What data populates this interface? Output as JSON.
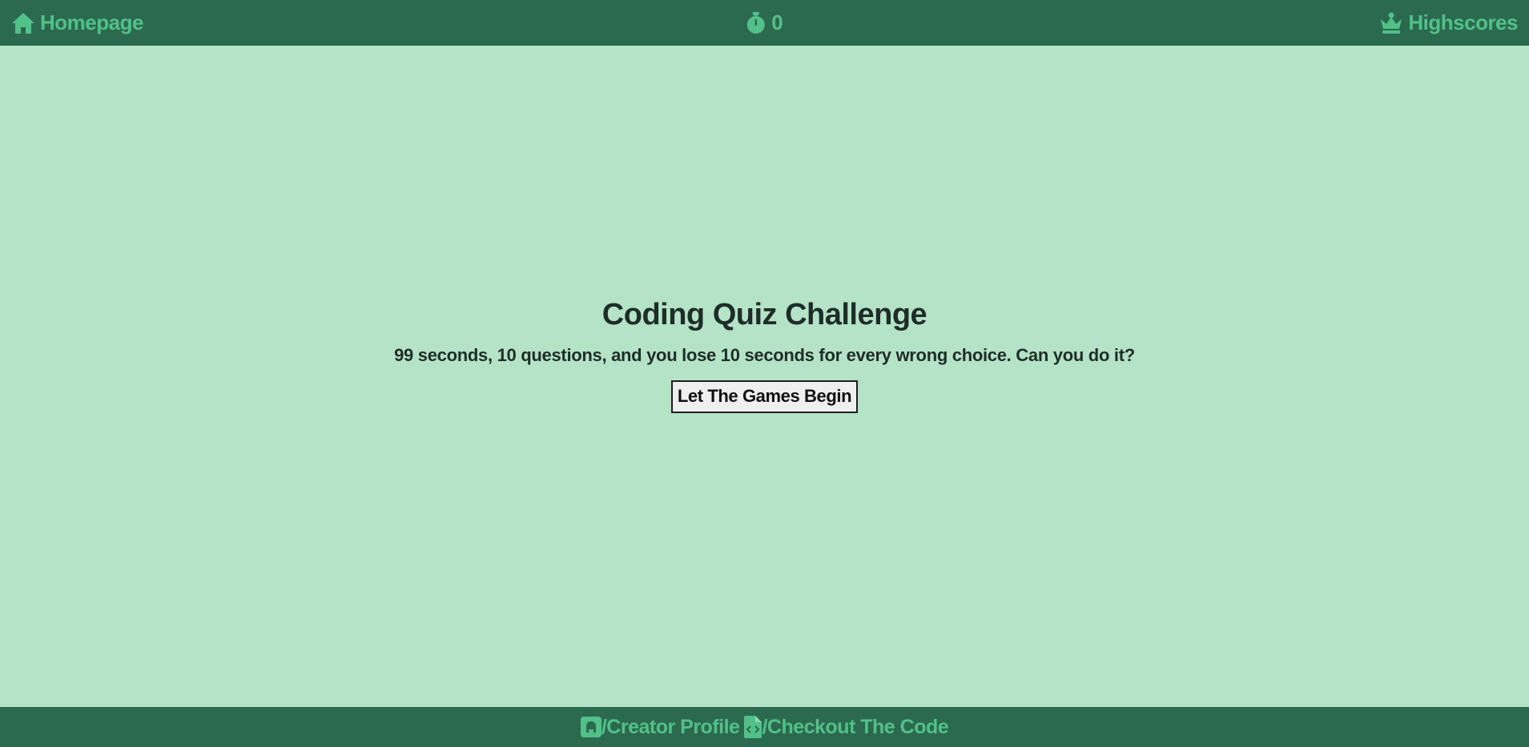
{
  "header": {
    "home_label": "Homepage",
    "timer_value": "0",
    "highscores_label": "Highscores"
  },
  "main": {
    "title": "Coding Quiz Challenge",
    "subtitle": "99 seconds, 10 questions, and you lose 10 seconds for every wrong choice. Can you do it?",
    "start_button_label": "Let The Games Begin"
  },
  "footer": {
    "creator_label": "/Creator Profile",
    "code_label": "/Checkout The Code"
  },
  "icons": {
    "home": "home-icon",
    "timer": "stopwatch-icon",
    "highscores": "crown-icon",
    "creator": "github-icon",
    "code": "file-code-icon"
  },
  "colors": {
    "bar_bg": "#2c6a4f",
    "accent": "#52c089",
    "page_bg": "#b5e3c8",
    "text": "#1e2d27"
  }
}
